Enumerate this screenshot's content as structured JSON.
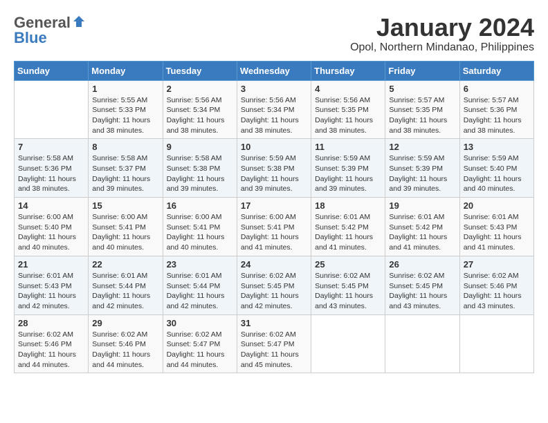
{
  "header": {
    "logo_general": "General",
    "logo_blue": "Blue",
    "month_title": "January 2024",
    "location": "Opol, Northern Mindanao, Philippines"
  },
  "weekdays": [
    "Sunday",
    "Monday",
    "Tuesday",
    "Wednesday",
    "Thursday",
    "Friday",
    "Saturday"
  ],
  "weeks": [
    [
      {
        "day": "",
        "sunrise": "",
        "sunset": "",
        "daylight": ""
      },
      {
        "day": "1",
        "sunrise": "Sunrise: 5:55 AM",
        "sunset": "Sunset: 5:33 PM",
        "daylight": "Daylight: 11 hours and 38 minutes."
      },
      {
        "day": "2",
        "sunrise": "Sunrise: 5:56 AM",
        "sunset": "Sunset: 5:34 PM",
        "daylight": "Daylight: 11 hours and 38 minutes."
      },
      {
        "day": "3",
        "sunrise": "Sunrise: 5:56 AM",
        "sunset": "Sunset: 5:34 PM",
        "daylight": "Daylight: 11 hours and 38 minutes."
      },
      {
        "day": "4",
        "sunrise": "Sunrise: 5:56 AM",
        "sunset": "Sunset: 5:35 PM",
        "daylight": "Daylight: 11 hours and 38 minutes."
      },
      {
        "day": "5",
        "sunrise": "Sunrise: 5:57 AM",
        "sunset": "Sunset: 5:35 PM",
        "daylight": "Daylight: 11 hours and 38 minutes."
      },
      {
        "day": "6",
        "sunrise": "Sunrise: 5:57 AM",
        "sunset": "Sunset: 5:36 PM",
        "daylight": "Daylight: 11 hours and 38 minutes."
      }
    ],
    [
      {
        "day": "7",
        "sunrise": "Sunrise: 5:58 AM",
        "sunset": "Sunset: 5:36 PM",
        "daylight": "Daylight: 11 hours and 38 minutes."
      },
      {
        "day": "8",
        "sunrise": "Sunrise: 5:58 AM",
        "sunset": "Sunset: 5:37 PM",
        "daylight": "Daylight: 11 hours and 39 minutes."
      },
      {
        "day": "9",
        "sunrise": "Sunrise: 5:58 AM",
        "sunset": "Sunset: 5:38 PM",
        "daylight": "Daylight: 11 hours and 39 minutes."
      },
      {
        "day": "10",
        "sunrise": "Sunrise: 5:59 AM",
        "sunset": "Sunset: 5:38 PM",
        "daylight": "Daylight: 11 hours and 39 minutes."
      },
      {
        "day": "11",
        "sunrise": "Sunrise: 5:59 AM",
        "sunset": "Sunset: 5:39 PM",
        "daylight": "Daylight: 11 hours and 39 minutes."
      },
      {
        "day": "12",
        "sunrise": "Sunrise: 5:59 AM",
        "sunset": "Sunset: 5:39 PM",
        "daylight": "Daylight: 11 hours and 39 minutes."
      },
      {
        "day": "13",
        "sunrise": "Sunrise: 5:59 AM",
        "sunset": "Sunset: 5:40 PM",
        "daylight": "Daylight: 11 hours and 40 minutes."
      }
    ],
    [
      {
        "day": "14",
        "sunrise": "Sunrise: 6:00 AM",
        "sunset": "Sunset: 5:40 PM",
        "daylight": "Daylight: 11 hours and 40 minutes."
      },
      {
        "day": "15",
        "sunrise": "Sunrise: 6:00 AM",
        "sunset": "Sunset: 5:41 PM",
        "daylight": "Daylight: 11 hours and 40 minutes."
      },
      {
        "day": "16",
        "sunrise": "Sunrise: 6:00 AM",
        "sunset": "Sunset: 5:41 PM",
        "daylight": "Daylight: 11 hours and 40 minutes."
      },
      {
        "day": "17",
        "sunrise": "Sunrise: 6:00 AM",
        "sunset": "Sunset: 5:41 PM",
        "daylight": "Daylight: 11 hours and 41 minutes."
      },
      {
        "day": "18",
        "sunrise": "Sunrise: 6:01 AM",
        "sunset": "Sunset: 5:42 PM",
        "daylight": "Daylight: 11 hours and 41 minutes."
      },
      {
        "day": "19",
        "sunrise": "Sunrise: 6:01 AM",
        "sunset": "Sunset: 5:42 PM",
        "daylight": "Daylight: 11 hours and 41 minutes."
      },
      {
        "day": "20",
        "sunrise": "Sunrise: 6:01 AM",
        "sunset": "Sunset: 5:43 PM",
        "daylight": "Daylight: 11 hours and 41 minutes."
      }
    ],
    [
      {
        "day": "21",
        "sunrise": "Sunrise: 6:01 AM",
        "sunset": "Sunset: 5:43 PM",
        "daylight": "Daylight: 11 hours and 42 minutes."
      },
      {
        "day": "22",
        "sunrise": "Sunrise: 6:01 AM",
        "sunset": "Sunset: 5:44 PM",
        "daylight": "Daylight: 11 hours and 42 minutes."
      },
      {
        "day": "23",
        "sunrise": "Sunrise: 6:01 AM",
        "sunset": "Sunset: 5:44 PM",
        "daylight": "Daylight: 11 hours and 42 minutes."
      },
      {
        "day": "24",
        "sunrise": "Sunrise: 6:02 AM",
        "sunset": "Sunset: 5:45 PM",
        "daylight": "Daylight: 11 hours and 42 minutes."
      },
      {
        "day": "25",
        "sunrise": "Sunrise: 6:02 AM",
        "sunset": "Sunset: 5:45 PM",
        "daylight": "Daylight: 11 hours and 43 minutes."
      },
      {
        "day": "26",
        "sunrise": "Sunrise: 6:02 AM",
        "sunset": "Sunset: 5:45 PM",
        "daylight": "Daylight: 11 hours and 43 minutes."
      },
      {
        "day": "27",
        "sunrise": "Sunrise: 6:02 AM",
        "sunset": "Sunset: 5:46 PM",
        "daylight": "Daylight: 11 hours and 43 minutes."
      }
    ],
    [
      {
        "day": "28",
        "sunrise": "Sunrise: 6:02 AM",
        "sunset": "Sunset: 5:46 PM",
        "daylight": "Daylight: 11 hours and 44 minutes."
      },
      {
        "day": "29",
        "sunrise": "Sunrise: 6:02 AM",
        "sunset": "Sunset: 5:46 PM",
        "daylight": "Daylight: 11 hours and 44 minutes."
      },
      {
        "day": "30",
        "sunrise": "Sunrise: 6:02 AM",
        "sunset": "Sunset: 5:47 PM",
        "daylight": "Daylight: 11 hours and 44 minutes."
      },
      {
        "day": "31",
        "sunrise": "Sunrise: 6:02 AM",
        "sunset": "Sunset: 5:47 PM",
        "daylight": "Daylight: 11 hours and 45 minutes."
      },
      {
        "day": "",
        "sunrise": "",
        "sunset": "",
        "daylight": ""
      },
      {
        "day": "",
        "sunrise": "",
        "sunset": "",
        "daylight": ""
      },
      {
        "day": "",
        "sunrise": "",
        "sunset": "",
        "daylight": ""
      }
    ]
  ]
}
